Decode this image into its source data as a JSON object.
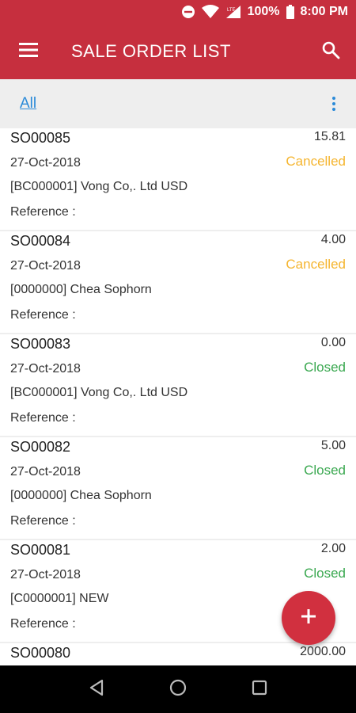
{
  "status_bar": {
    "battery": "100%",
    "time": "8:00 PM",
    "network": "LTE"
  },
  "app_bar": {
    "title": "SALE ORDER LIST"
  },
  "filter": {
    "label": "All"
  },
  "colors": {
    "primary": "#c62f3e",
    "fab": "#d1303f",
    "link": "#2a8ad8",
    "cancelled": "#f5b52f",
    "closed": "#3aa850"
  },
  "orders": [
    {
      "number": "SO00085",
      "amount": "15.81",
      "date": "27-Oct-2018",
      "status": "Cancelled",
      "customer": "[BC000001] Vong Co,. Ltd USD",
      "reference": "Reference :"
    },
    {
      "number": "SO00084",
      "amount": "4.00",
      "date": "27-Oct-2018",
      "status": "Cancelled",
      "customer": "[0000000] Chea Sophorn",
      "reference": "Reference :"
    },
    {
      "number": "SO00083",
      "amount": "0.00",
      "date": "27-Oct-2018",
      "status": "Closed",
      "customer": "[BC000001] Vong Co,. Ltd USD",
      "reference": "Reference :"
    },
    {
      "number": "SO00082",
      "amount": "5.00",
      "date": "27-Oct-2018",
      "status": "Closed",
      "customer": "[0000000] Chea Sophorn",
      "reference": "Reference :"
    },
    {
      "number": "SO00081",
      "amount": "2.00",
      "date": "27-Oct-2018",
      "status": "Closed",
      "customer": "[C0000001] NEW",
      "reference": "Reference :"
    },
    {
      "number": "SO00080",
      "amount": "2000.00",
      "date": "",
      "status": "",
      "customer": "",
      "reference": ""
    }
  ]
}
